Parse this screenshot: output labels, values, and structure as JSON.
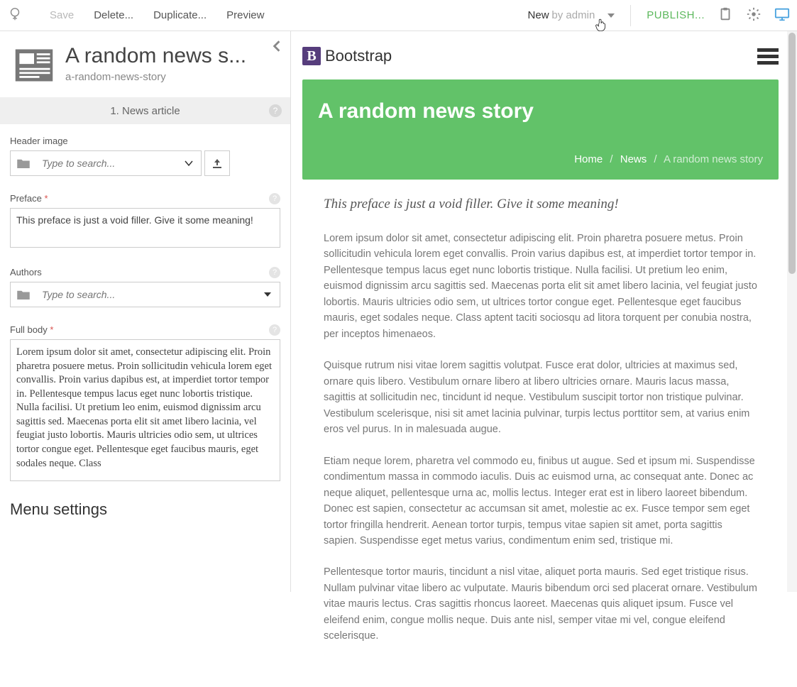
{
  "toolbar": {
    "save": "Save",
    "delete": "Delete...",
    "duplicate": "Duplicate...",
    "preview": "Preview",
    "status_new": "New",
    "status_byadmin": "by admin",
    "publish": "PUBLISH..."
  },
  "editor": {
    "title": "A random news s...",
    "slug": "a-random-news-story",
    "crumb": "1. News article",
    "fields": {
      "header_image": {
        "label": "Header image",
        "placeholder": "Type to search..."
      },
      "preface": {
        "label": "Preface",
        "value": "This preface is just a void filler. Give it some meaning!"
      },
      "authors": {
        "label": "Authors",
        "placeholder": "Type to search..."
      },
      "full_body": {
        "label": "Full body",
        "value": "Lorem ipsum dolor sit amet, consectetur adipiscing elit. Proin pharetra posuere metus. Proin sollicitudin vehicula lorem eget convallis. Proin varius dapibus est, at imperdiet tortor tempor in. Pellentesque tempus lacus eget nunc lobortis tristique. Nulla facilisi. Ut pretium leo enim, euismod dignissim arcu sagittis sed. Maecenas porta elit sit amet libero lacinia, vel feugiat justo lobortis. Mauris ultricies odio sem, ut ultrices tortor congue eget. Pellentesque eget faucibus mauris, eget sodales neque. Class"
      }
    },
    "menu_settings": "Menu settings"
  },
  "preview": {
    "brand": "Bootstrap",
    "hero_title": "A random news story",
    "breadcrumb": {
      "home": "Home",
      "news": "News",
      "current": "A random news story"
    },
    "preface": "This preface is just a void filler. Give it some meaning!",
    "paragraphs": [
      "Lorem ipsum dolor sit amet, consectetur adipiscing elit. Proin pharetra posuere metus. Proin sollicitudin vehicula lorem eget convallis. Proin varius dapibus est, at imperdiet tortor tempor in. Pellentesque tempus lacus eget nunc lobortis tristique. Nulla facilisi. Ut pretium leo enim, euismod dignissim arcu sagittis sed. Maecenas porta elit sit amet libero lacinia, vel feugiat justo lobortis. Mauris ultricies odio sem, ut ultrices tortor congue eget. Pellentesque eget faucibus mauris, eget sodales neque. Class aptent taciti sociosqu ad litora torquent per conubia nostra, per inceptos himenaeos.",
      "Quisque rutrum nisi vitae lorem sagittis volutpat. Fusce erat dolor, ultricies at maximus sed, ornare quis libero. Vestibulum ornare libero at libero ultricies ornare. Mauris lacus massa, sagittis at sollicitudin nec, tincidunt id neque. Vestibulum suscipit tortor non tristique pulvinar. Vestibulum scelerisque, nisi sit amet lacinia pulvinar, turpis lectus porttitor sem, at varius enim eros vel purus. In in malesuada augue.",
      "Etiam neque lorem, pharetra vel commodo eu, finibus ut augue. Sed et ipsum mi. Suspendisse condimentum massa in commodo iaculis. Duis ac euismod urna, ac consequat ante. Donec ac neque aliquet, pellentesque urna ac, mollis lectus. Integer erat est in libero laoreet bibendum. Donec est sapien, consectetur ac accumsan sit amet, molestie ac ex. Fusce tempor sem eget tortor fringilla hendrerit. Aenean tortor turpis, tempus vitae sapien sit amet, porta sagittis sapien. Suspendisse eget metus varius, condimentum enim sed, tristique mi.",
      "Pellentesque tortor mauris, tincidunt a nisl vitae, aliquet porta mauris. Sed eget tristique risus. Nullam pulvinar vitae libero ac vulputate. Mauris bibendum orci sed placerat ornare. Vestibulum vitae mauris lectus. Cras sagittis rhoncus laoreet. Maecenas quis aliquet ipsum. Fusce vel eleifend enim, congue mollis neque. Duis ante nisl, semper vitae mi vel, congue eleifend scelerisque."
    ]
  }
}
